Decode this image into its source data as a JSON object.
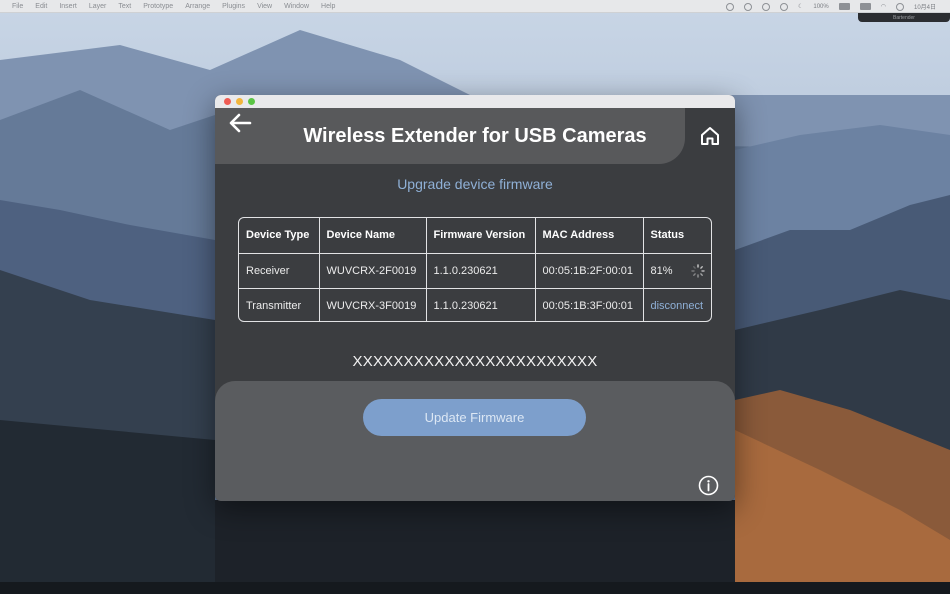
{
  "menubar": {
    "items": [
      "File",
      "Edit",
      "Insert",
      "Layer",
      "Text",
      "Prototype",
      "Arrange",
      "Plugins",
      "View",
      "Window",
      "Help"
    ],
    "battery": "100%",
    "clock": "10月4日",
    "popup_label": "Bartender"
  },
  "app": {
    "title": "Wireless Extender for USB Cameras",
    "subtitle": "Upgrade device firmware",
    "back_icon": "arrow-left-icon",
    "home_icon": "home-icon",
    "info_icon": "info-icon"
  },
  "table": {
    "headers": [
      "Device Type",
      "Device Name",
      "Firmware Version",
      "MAC Address",
      "Status"
    ],
    "rows": [
      {
        "type": "Receiver",
        "name": "WUVCRX-2F0019",
        "firmware": "1.1.0.230621",
        "mac": "00:05:1B:2F:00:01",
        "status": "81%",
        "progress": 0.81
      },
      {
        "type": "Transmitter",
        "name": "WUVCRX-3F0019",
        "firmware": "1.1.0.230621",
        "mac": "00:05:1B:3F:00:01",
        "status": "disconnect"
      }
    ]
  },
  "placeholder_id": "XXXXXXXXXXXXXXXXXXXXXXXX",
  "actions": {
    "update_label": "Update Firmware"
  },
  "colors": {
    "accent": "#7d9fcc",
    "link": "#8fb0d6",
    "window_bg": "#3b3d40",
    "header_bg": "#58595b"
  }
}
